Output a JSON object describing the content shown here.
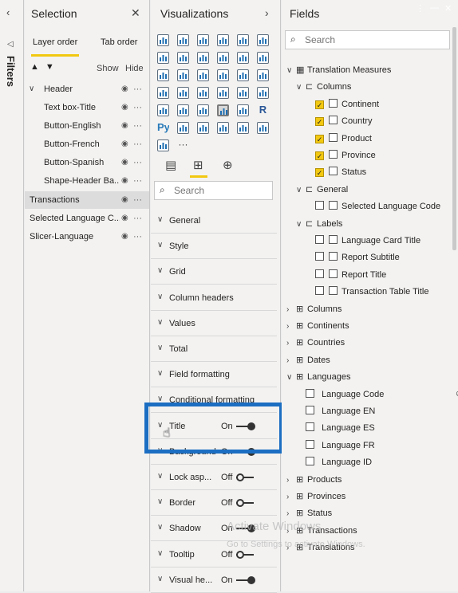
{
  "filters": {
    "label": "Filters"
  },
  "selection": {
    "title": "Selection",
    "tabs": [
      "Layer order",
      "Tab order"
    ],
    "show_label": "Show",
    "hide_label": "Hide",
    "layers": [
      {
        "label": "Header"
      },
      {
        "label": "Text box-Title"
      },
      {
        "label": "Button-English"
      },
      {
        "label": "Button-French"
      },
      {
        "label": "Button-Spanish"
      },
      {
        "label": "Shape-Header Ba..."
      },
      {
        "label": "Transactions"
      },
      {
        "label": "Selected Language C..."
      },
      {
        "label": "Slicer-Language"
      }
    ]
  },
  "visualizations": {
    "title": "Visualizations",
    "icons": [
      "stacked-bar",
      "stacked-column",
      "clustered-bar",
      "clustered-column",
      "100-bar",
      "100-column",
      "line",
      "area",
      "stacked-area",
      "line-column",
      "line-clustered",
      "ribbon",
      "waterfall",
      "funnel",
      "scatter",
      "pie",
      "donut",
      "treemap",
      "map",
      "filled-map",
      "shape-map",
      "table",
      "gauge",
      "card",
      "multirow-card",
      "kpi",
      "slicer",
      "table-grid",
      "matrix",
      "r-visual",
      "python-visual",
      "key-influencers",
      "decomposition-tree",
      "qa",
      "smart-narrative",
      "paginated",
      "custom-visual",
      "more"
    ],
    "python_label": "Py",
    "r_label": "R",
    "more_label": "···",
    "search_placeholder": "Search",
    "format_cards": [
      {
        "label": "General"
      },
      {
        "label": "Style"
      },
      {
        "label": "Grid"
      },
      {
        "label": "Column headers"
      },
      {
        "label": "Values"
      },
      {
        "label": "Total"
      },
      {
        "label": "Field formatting"
      },
      {
        "label": "Conditional formatting"
      },
      {
        "label": "Title",
        "state": "On"
      },
      {
        "label": "Background",
        "state": "On"
      },
      {
        "label": "Lock asp...",
        "state": "Off"
      },
      {
        "label": "Border",
        "state": "Off"
      },
      {
        "label": "Shadow",
        "state": "On"
      },
      {
        "label": "Tooltip",
        "state": "Off"
      },
      {
        "label": "Visual he...",
        "state": "On"
      }
    ]
  },
  "fields": {
    "title": "Fields",
    "search_placeholder": "Search",
    "tree": {
      "translation_measures": "Translation Measures",
      "columns_folder": "Columns",
      "columns_items": [
        "Continent",
        "Country",
        "Product",
        "Province",
        "Status"
      ],
      "general_folder": "General",
      "general_items": [
        "Selected Language Code"
      ],
      "labels_folder": "Labels",
      "labels_items": [
        "Language Card Title",
        "Report Subtitle",
        "Report Title",
        "Transaction Table Title"
      ],
      "tables_a": [
        "Columns",
        "Continents",
        "Countries",
        "Dates"
      ],
      "languages_table": "Languages",
      "languages_items": [
        "Language Code",
        "Language EN",
        "Language ES",
        "Language FR",
        "Language ID"
      ],
      "tables_b": [
        "Products",
        "Provinces",
        "Status",
        "Transactions",
        "Translations"
      ]
    }
  },
  "watermark": {
    "line1": "Activate Windows",
    "line2": "Go to Settings to activate Windows."
  },
  "colors": {
    "accent": "#f2c811",
    "highlight": "#1b6ec2"
  }
}
